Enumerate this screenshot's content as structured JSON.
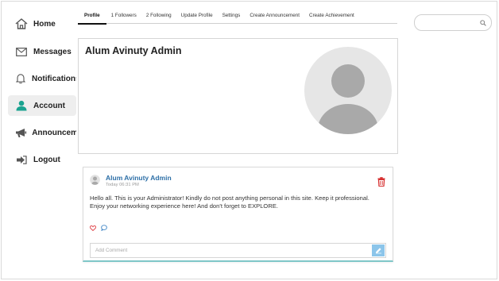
{
  "sidebar": {
    "items": [
      {
        "label": "Home",
        "icon": "home-icon"
      },
      {
        "label": "Messages",
        "icon": "envelope-icon"
      },
      {
        "label": "Notifications",
        "icon": "bell-icon"
      },
      {
        "label": "Account",
        "icon": "user-icon",
        "active": true
      },
      {
        "label": "Announcements",
        "icon": "megaphone-icon"
      },
      {
        "label": "Logout",
        "icon": "logout-icon"
      }
    ]
  },
  "tabs": [
    {
      "label": "Profile",
      "active": true
    },
    {
      "label": "1 Followers"
    },
    {
      "label": "2 Following"
    },
    {
      "label": "Update Profile"
    },
    {
      "label": "Settings"
    },
    {
      "label": "Create Announcement"
    },
    {
      "label": "Create Achievement"
    }
  ],
  "search": {
    "placeholder": "",
    "icon": "search-icon"
  },
  "profile": {
    "name": "Alum Avinuty Admin"
  },
  "post": {
    "author": "Alum Avinuty Admin",
    "time": "Today 06:31 PM",
    "body": "Hello all. This is your Administrator! Kindly do not post anything personal in this site. Keep it professional. Enjoy your networking experience here! And don't forget to EXPLORE.",
    "comment_placeholder": "Add Comment"
  },
  "colors": {
    "accent_green": "#1aa390",
    "link_blue": "#2d6fa7",
    "delete_red": "#d62d2d",
    "like_red": "#e0444a",
    "comment_blue": "#3a82c4",
    "submit_blue": "#8cc5ea",
    "card_border_teal": "#7fc7c8"
  }
}
